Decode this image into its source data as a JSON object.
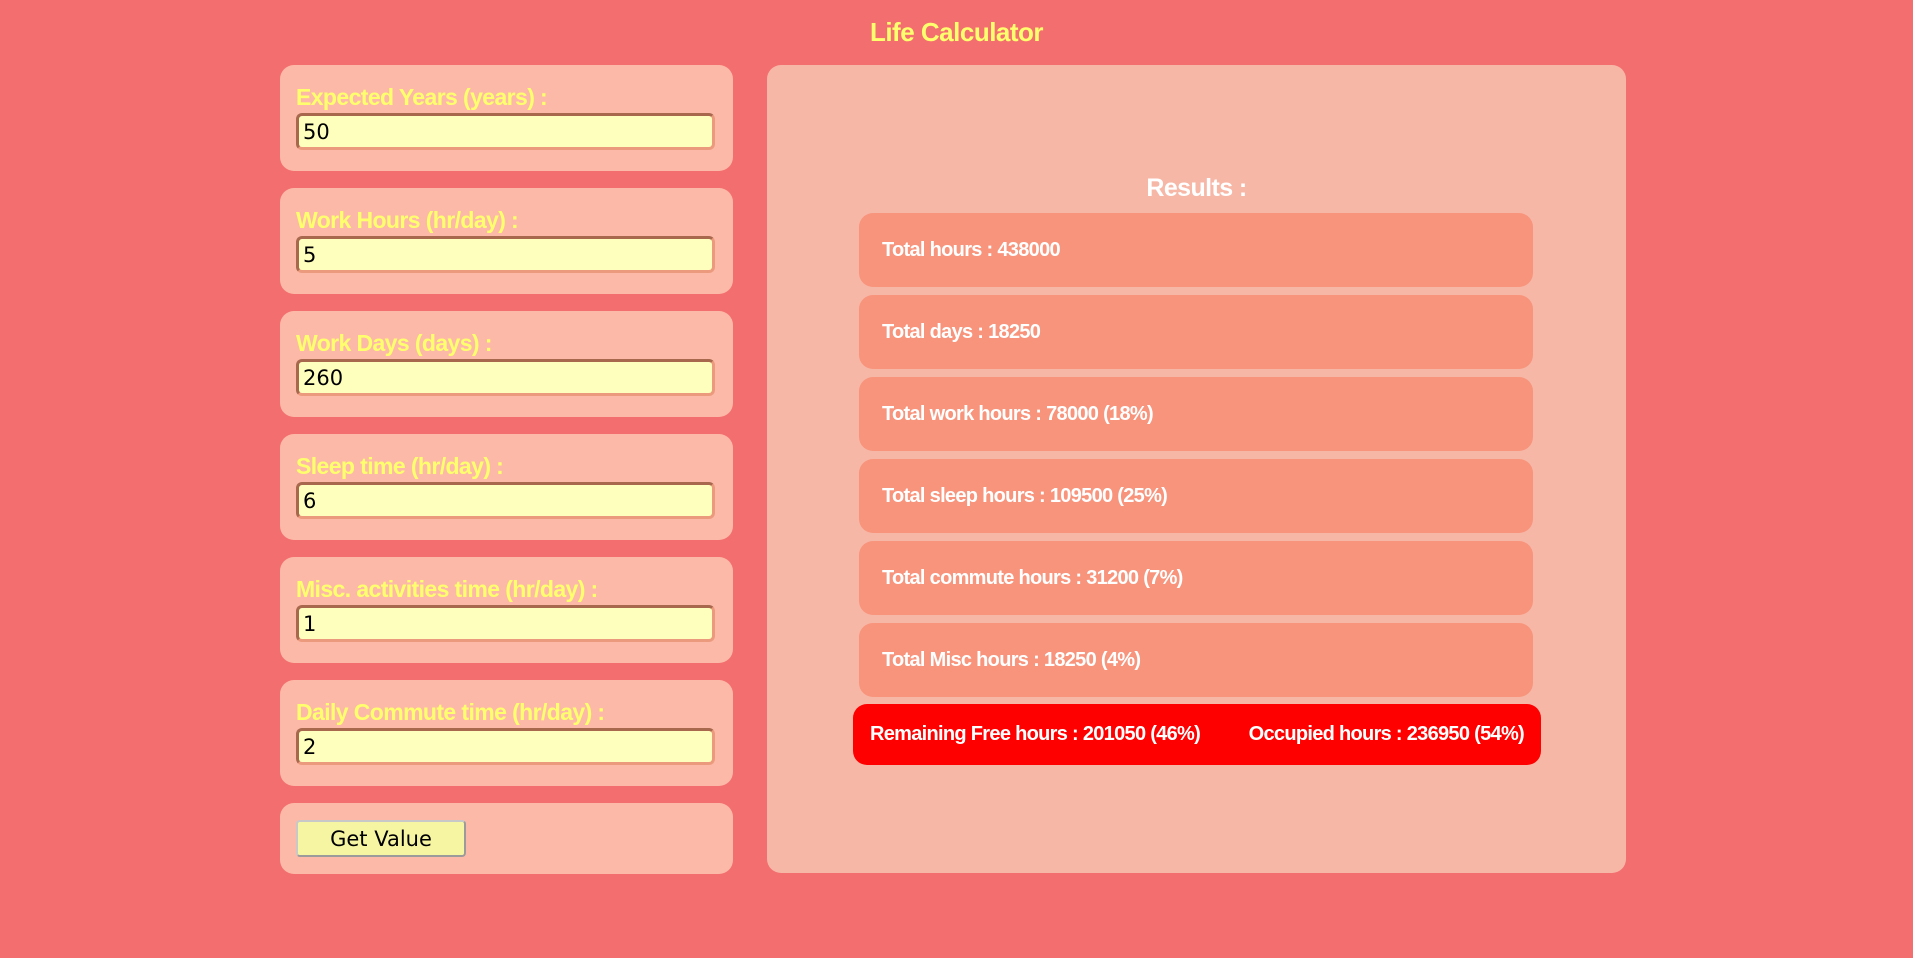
{
  "title": "Life Calculator",
  "colors": {
    "background": "#f36e6e",
    "card": "#fdb9a7",
    "results_panel": "#f7b7a7",
    "result_row": "#f8947c",
    "summary_bar": "#ff0000",
    "label_yellow": "#ffff6e",
    "input_bg": "#ffffbd",
    "button_bg": "#f6f6a2"
  },
  "fields": [
    {
      "label": "Expected Years (years) :",
      "value": "50"
    },
    {
      "label": "Work Hours (hr/day) :",
      "value": "5"
    },
    {
      "label": "Work Days (days) :",
      "value": "260"
    },
    {
      "label": "Sleep time (hr/day) :",
      "value": "6"
    },
    {
      "label": "Misc. activities time (hr/day) :",
      "value": "1"
    },
    {
      "label": "Daily Commute time (hr/day) :",
      "value": "2"
    }
  ],
  "button": {
    "label": "Get Value"
  },
  "results": {
    "heading": "Results :",
    "rows": [
      "Total hours : 438000",
      "Total days : 18250",
      "Total work hours : 78000 (18%)",
      "Total sleep hours : 109500 (25%)",
      "Total commute hours : 31200 (7%)",
      "Total Misc hours : 18250 (4%)"
    ],
    "remaining": "Remaining Free hours : 201050 (46%)",
    "occupied": "Occupied hours : 236950 (54%)"
  }
}
